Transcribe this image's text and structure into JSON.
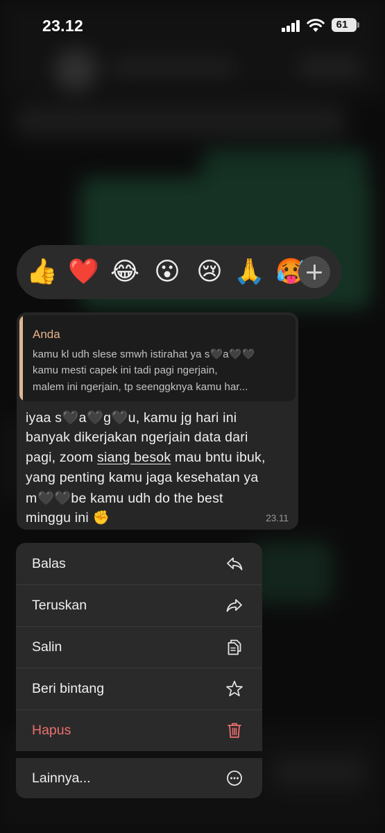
{
  "status_bar": {
    "time": "23.12",
    "battery": "61"
  },
  "reactions": [
    {
      "emoji": "👍",
      "name": "thumbs-up"
    },
    {
      "emoji": "❤️",
      "name": "red-heart"
    },
    {
      "emoji": "😂",
      "name": "tears-of-joy"
    },
    {
      "emoji": "😮",
      "name": "open-mouth"
    },
    {
      "emoji": "😢",
      "name": "crying-face"
    },
    {
      "emoji": "🙏",
      "name": "folded-hands"
    },
    {
      "emoji": "🥵",
      "name": "hot-face"
    }
  ],
  "message": {
    "quote_author": "Anda",
    "quote_lines": [
      "kamu kl udh slese smwh istirahat ya s🖤a🖤🖤",
      "kamu mesti capek ini tadi pagi ngerjain,",
      "malem ini ngerjain, tp seenggknya kamu har..."
    ],
    "lines": {
      "l1": "iyaa s🖤a🖤g🖤u, kamu jg hari ini",
      "l2": "banyak dikerjakan ngerjain data dari",
      "l3_a": "pagi, zoom ",
      "l3_link": "siang besok",
      "l3_b": " mau bntu ibuk,",
      "l4": "yang penting kamu jaga kesehatan ya",
      "l5": "m🖤🖤be kamu udh do the best",
      "l6": "minggu ini ✊"
    },
    "time": "23.11"
  },
  "menu": {
    "reply": "Balas",
    "forward": "Teruskan",
    "copy": "Salin",
    "star": "Beri bintang",
    "delete": "Hapus",
    "more": "Lainnya..."
  },
  "colors": {
    "delete": "#ec6f6f",
    "quote_accent": "#e0b693"
  }
}
